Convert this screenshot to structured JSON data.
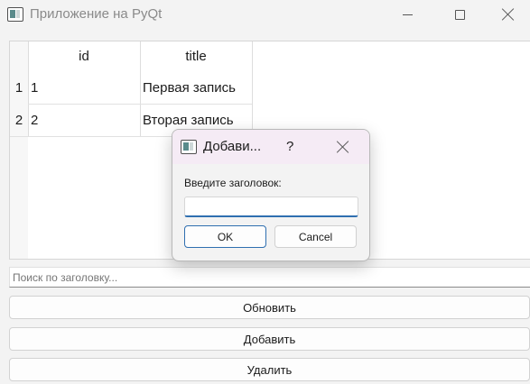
{
  "window": {
    "title": "Приложение на PyQt",
    "icon": "app-window-icon"
  },
  "table": {
    "columns": [
      "id",
      "title"
    ],
    "rows": [
      {
        "header": "1",
        "id": "1",
        "title": "Первая запись"
      },
      {
        "header": "2",
        "id": "2",
        "title": "Вторая запись"
      }
    ]
  },
  "search": {
    "placeholder": "Поиск по заголовку...",
    "value": ""
  },
  "buttons": {
    "refresh": "Обновить",
    "add": "Добавить",
    "delete": "Удалить"
  },
  "dialog": {
    "title": "Добави...",
    "help": "?",
    "label": "Введите заголовок:",
    "input_value": "",
    "ok": "OK",
    "cancel": "Cancel"
  },
  "colors": {
    "focus_accent": "#2f6fb0",
    "dialog_titlebar": "#f5ebf5"
  }
}
